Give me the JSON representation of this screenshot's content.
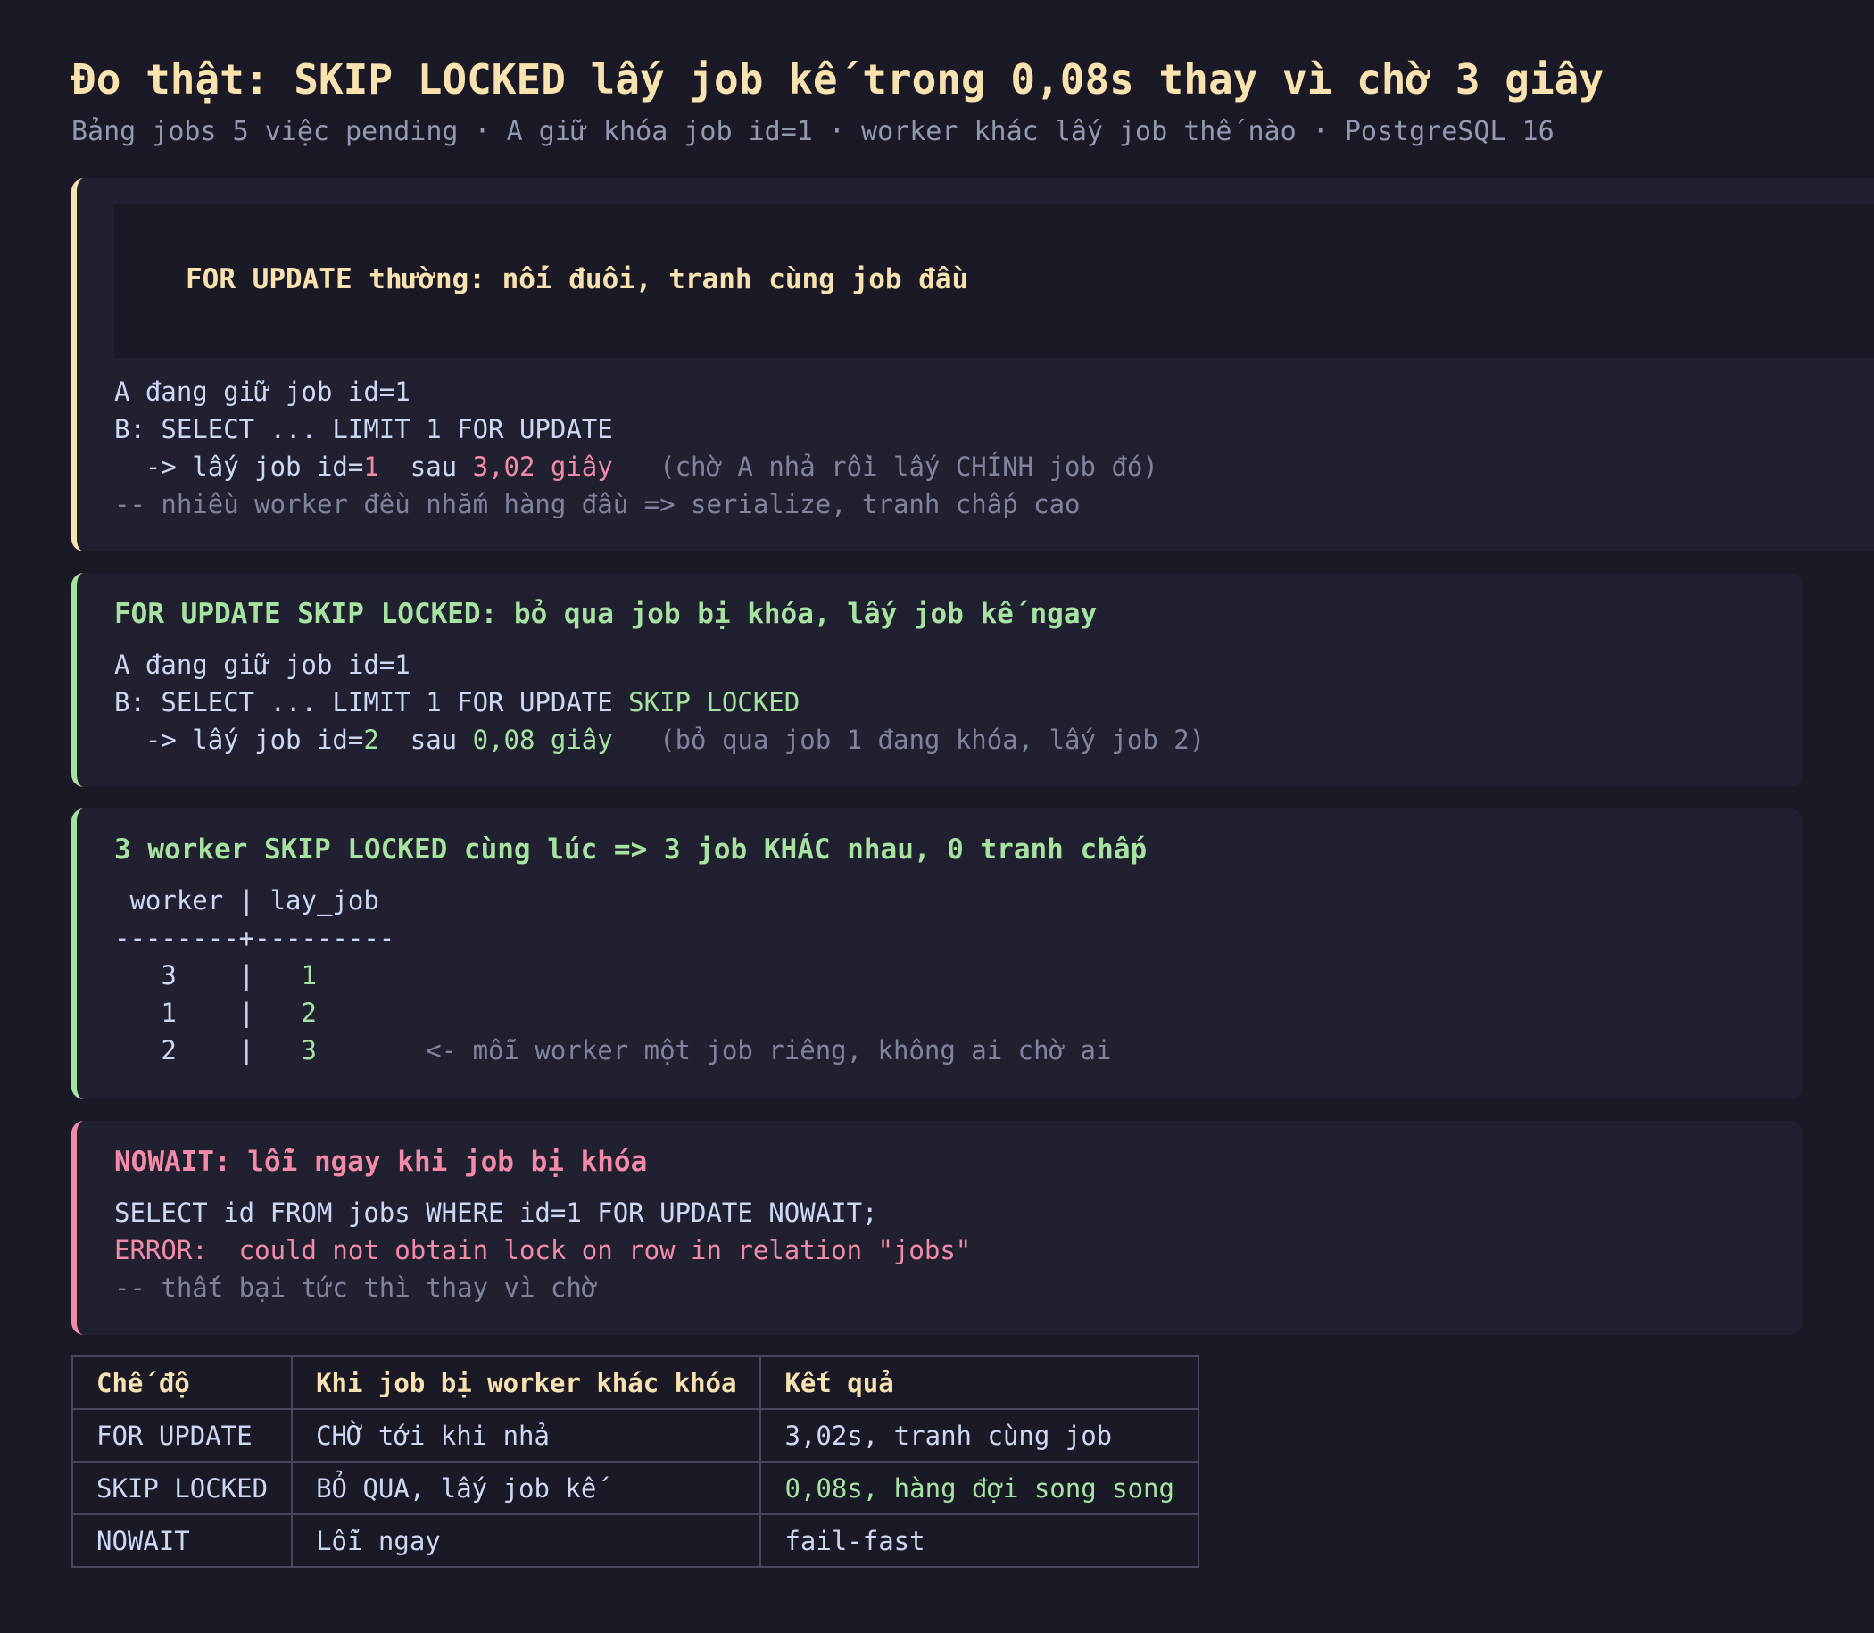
{
  "header": {
    "title": "Đo thật: SKIP LOCKED lấy job kế trong 0,08s thay vì chờ 3 giây",
    "subtitle": "Bảng jobs 5 việc pending · A giữ khóa job id=1 · worker khác lấy job thế nào · PostgreSQL 16"
  },
  "card_for_update": {
    "heading": "FOR UPDATE thường: nối đuôi, tranh cùng job đầu",
    "line1": "A đang giữ job id=1",
    "line2": "B: SELECT ... LIMIT 1 FOR UPDATE",
    "line3_prefix": "  -> lấy job id=",
    "line3_id": "1",
    "line3_mid": "  sau ",
    "line3_time": "3,02 giây",
    "line3_note": "   (chờ A nhả rồi lấy CHÍNH job đó)",
    "comment": "-- nhiều worker đều nhắm hàng đầu => serialize, tranh chấp cao"
  },
  "card_skip_locked": {
    "heading": "FOR UPDATE SKIP LOCKED: bỏ qua job bị khóa, lấy job kế ngay",
    "line1": "A đang giữ job id=1",
    "line2_prefix": "B: SELECT ... LIMIT 1 FOR UPDATE ",
    "line2_kw": "SKIP LOCKED",
    "line3_prefix": "  -> lấy job id=",
    "line3_id": "2",
    "line3_mid": "  sau ",
    "line3_time": "0,08 giây",
    "line3_note": "   (bỏ qua job 1 đang khóa, lấy job 2)"
  },
  "card_three_workers": {
    "heading": "3 worker SKIP LOCKED cùng lúc => 3 job KHÁC nhau, 0 tranh chấp",
    "table_header": " worker | lay_job",
    "separator": "--------+---------",
    "rows": [
      {
        "worker": "   3    |   ",
        "job": "1",
        "note": ""
      },
      {
        "worker": "   1    |   ",
        "job": "2",
        "note": ""
      },
      {
        "worker": "   2    |   ",
        "job": "3",
        "note": "       <- mỗi worker một job riêng, không ai chờ ai"
      }
    ]
  },
  "card_nowait": {
    "heading": "NOWAIT: lỗi ngay khi job bị khóa",
    "line1": "SELECT id FROM jobs WHERE id=1 FOR UPDATE NOWAIT;",
    "line2": "ERROR:  could not obtain lock on row in relation \"jobs\"",
    "comment": "-- thất bại tức thì thay vì chờ"
  },
  "summary_table": {
    "headers": [
      "Chế độ",
      "Khi job bị worker khác khóa",
      "Kết quả"
    ],
    "rows": [
      [
        "FOR UPDATE",
        "CHỜ tới khi nhả",
        "3,02s, tranh cùng job"
      ],
      [
        "SKIP LOCKED",
        "BỎ QUA, lấy job kế",
        "0,08s, hàng đợi song song"
      ],
      [
        "NOWAIT",
        "Lỗi ngay",
        "fail-fast"
      ]
    ]
  },
  "colors": {
    "background": "#1a1a26",
    "card": "#202030",
    "yellow": "#f9e2af",
    "green": "#a6e3a1",
    "red": "#f38ba8",
    "muted": "#7f849c",
    "text": "#cdd6f4"
  }
}
